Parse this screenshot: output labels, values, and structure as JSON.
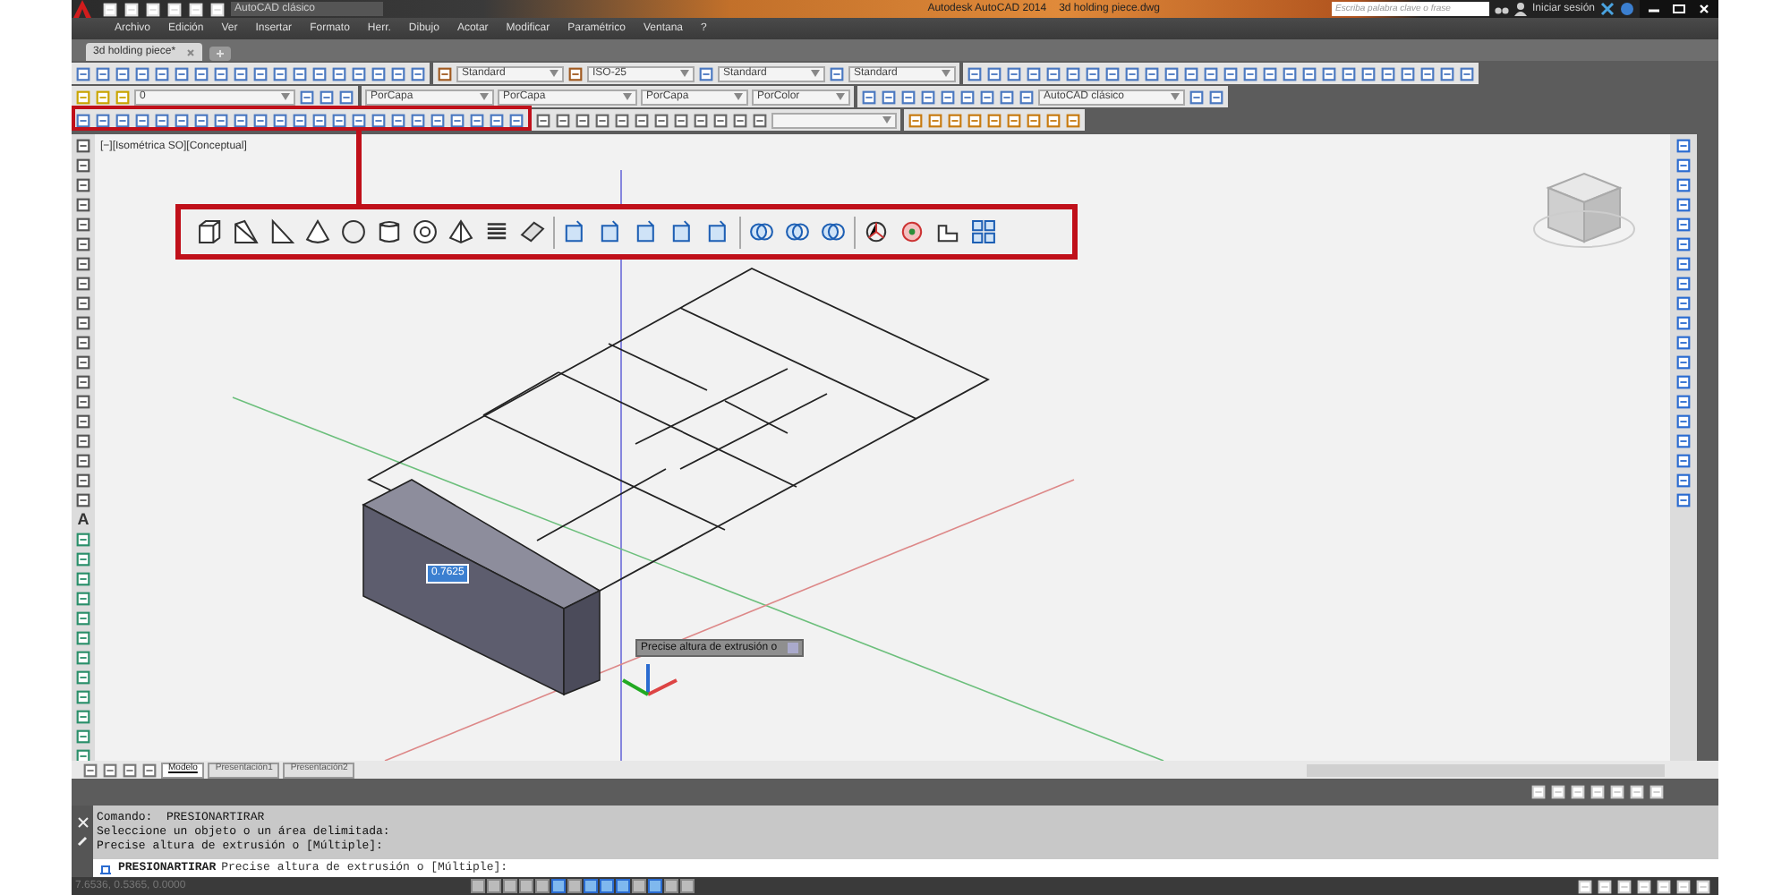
{
  "title_bar": {
    "workspace": "AutoCAD clásico",
    "title": "Autodesk AutoCAD 2014",
    "file": "3d holding piece.dwg",
    "search": {
      "placeholder": "Escriba palabra clave o frase"
    },
    "sign_in": "Iniciar sesión"
  },
  "menu_bar": {
    "items": [
      "Archivo",
      "Edición",
      "Ver",
      "Insertar",
      "Formato",
      "Herr.",
      "Dibujo",
      "Acotar",
      "Modificar",
      "Paramétrico",
      "Ventana",
      "?"
    ]
  },
  "document_tabs": [
    {
      "label": "3d holding piece*",
      "selected": true
    }
  ],
  "toolbars": {
    "text_style": "Standard",
    "dim_style": "ISO-25",
    "table_style": "Standard",
    "multileader_style": "Standard",
    "layer": "0",
    "color_control": "PorCapa",
    "linetype": "PorCapa",
    "lineweight": "PorCapa",
    "plot_style": "PorColor",
    "workspace": "AutoCAD clásico"
  },
  "viewport": {
    "label": "[−][Isométrica SO][Conceptual]",
    "dynamic_input": "0.7625",
    "tooltip": "Precise altura de extrusión o"
  },
  "left_toolbar": {
    "text_tool": "A"
  },
  "layout_tabs": [
    {
      "label": "Modelo",
      "selected": true
    },
    {
      "label": "Presentación1",
      "selected": false
    },
    {
      "label": "Presentación2",
      "selected": false
    }
  ],
  "command_history": [
    "Comando:  PRESIONARTIRAR",
    "Seleccione un objeto o un área delimitada:",
    "Precise altura de extrusión o [Múltiple]:"
  ],
  "command_line": {
    "command": "PRESIONARTIRAR",
    "prompt": "Precise altura de extrusión o [Múltiple]:"
  },
  "status_bar": {
    "coordinates": "7.6536, 0.5365, 0.0000",
    "toggles": [
      {
        "on": false
      },
      {
        "on": false
      },
      {
        "on": false
      },
      {
        "on": false
      },
      {
        "on": false
      },
      {
        "on": true
      },
      {
        "on": false
      },
      {
        "on": true
      },
      {
        "on": true
      },
      {
        "on": true
      },
      {
        "on": false
      },
      {
        "on": true
      },
      {
        "on": false
      },
      {
        "on": false
      }
    ]
  }
}
